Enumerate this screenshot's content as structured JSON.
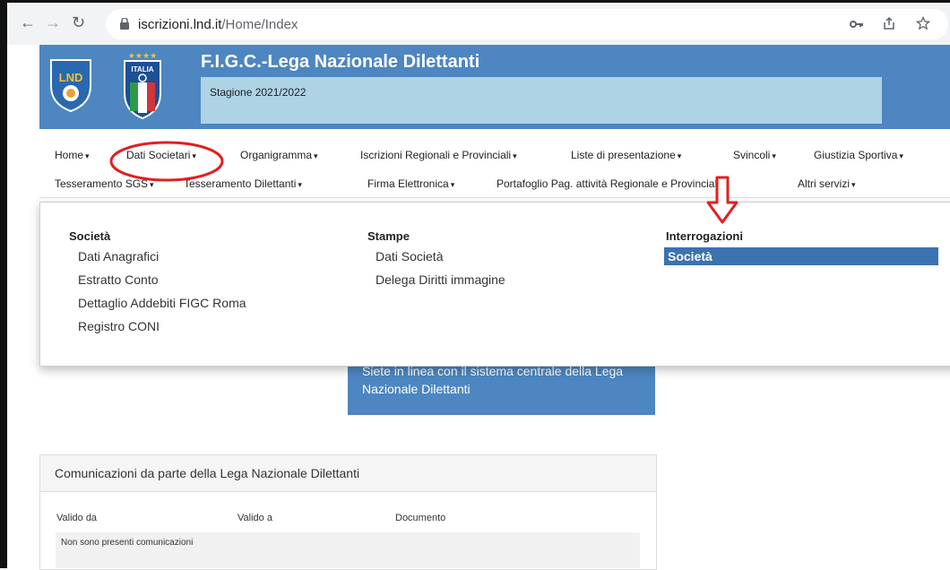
{
  "browser": {
    "url_host": "iscrizioni.lnd.it",
    "url_path": "/Home/Index"
  },
  "header": {
    "title": "F.I.G.C.-Lega Nazionale Dilettanti",
    "season": "Stagione 2021/2022",
    "logo_lnd_text": "LND",
    "logo_italia_text": "ITALIA"
  },
  "nav": {
    "row1": [
      {
        "label": "Home"
      },
      {
        "label": "Dati Societari"
      },
      {
        "label": "Organigramma"
      },
      {
        "label": "Iscrizioni Regionali e Provinciali"
      },
      {
        "label": "Liste di presentazione"
      },
      {
        "label": "Svincoli"
      },
      {
        "label": "Giustizia Sportiva"
      }
    ],
    "row2": [
      {
        "label": "Tesseramento SGS"
      },
      {
        "label": "Tesseramento Dilettanti"
      },
      {
        "label": "Firma Elettronica"
      },
      {
        "label": "Portafoglio Pag. attività Regionale e Provinciale"
      },
      {
        "label": "Altri servizi"
      }
    ],
    "caret": "▾"
  },
  "menu": {
    "columns": [
      {
        "heading": "Società",
        "items": [
          "Dati Anagrafici",
          "Estratto Conto",
          "Dettaglio Addebiti FIGC Roma",
          "Registro CONI"
        ]
      },
      {
        "heading": "Stampe",
        "items": [
          "Dati Società",
          "Delega Diritti immagine"
        ]
      },
      {
        "heading": "Interrogazioni",
        "items": [
          "Società"
        ]
      }
    ]
  },
  "info": {
    "text": "Siete in linea con il sistema centrale della Lega Nazionale Dilettanti"
  },
  "communications": {
    "title": "Comunicazioni da parte della Lega Nazionale Dilettanti",
    "columns": [
      "Valido da",
      "Valido a",
      "Documento"
    ],
    "empty_message": "Non sono presenti comunicazioni"
  },
  "colors": {
    "header_blue": "#4d86c0",
    "season_box": "#aed3e4",
    "highlight": "#3b72b0",
    "annotation_red": "#e02020"
  },
  "icons": [
    "back-icon",
    "forward-icon",
    "reload-icon",
    "lock-icon",
    "key-icon",
    "share-icon",
    "star-icon"
  ]
}
